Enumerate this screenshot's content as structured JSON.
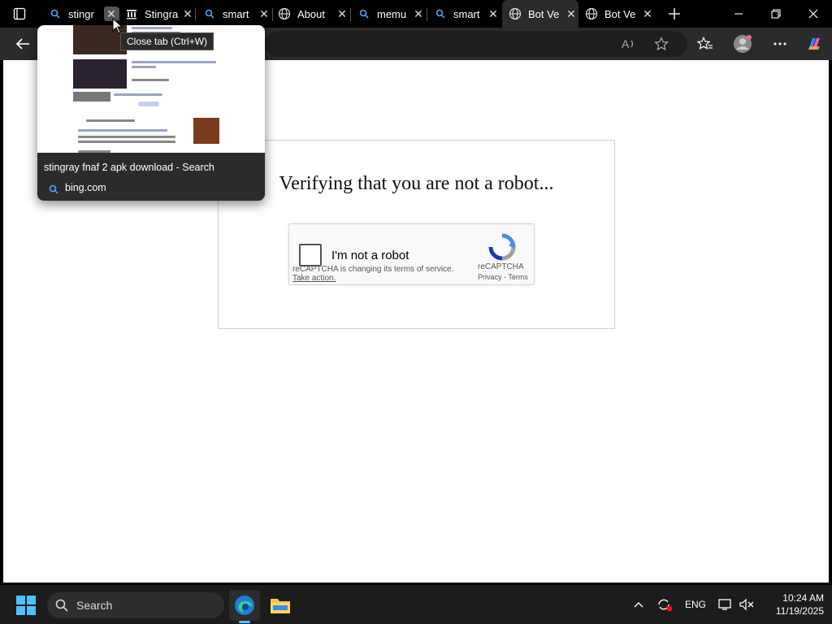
{
  "tabs": [
    {
      "title": "stingr",
      "icon": "search-icon",
      "active": false,
      "hovered": true
    },
    {
      "title": "Stingra",
      "icon": "library-icon",
      "active": false
    },
    {
      "title": "smart",
      "icon": "search-icon",
      "active": false
    },
    {
      "title": "About",
      "icon": "globe-icon",
      "active": false
    },
    {
      "title": "memu",
      "icon": "search-icon",
      "active": false
    },
    {
      "title": "smart",
      "icon": "search-icon",
      "active": false
    },
    {
      "title": "Bot Ve",
      "icon": "globe-icon",
      "active": true
    },
    {
      "title": "Bot Ve",
      "icon": "globe-icon",
      "active": false
    }
  ],
  "tooltip": "Close tab (Ctrl+W)",
  "hovercard": {
    "title": "stingray fnaf 2 apk download - Search",
    "domain": "bing.com"
  },
  "page": {
    "heading": "Verifying that you are not a robot...",
    "recaptcha": {
      "label": "I'm not a robot",
      "notice": "reCAPTCHA is changing its terms of service.",
      "action": "Take action.",
      "brand": "reCAPTCHA",
      "privacy": "Privacy",
      "terms": "Terms"
    }
  },
  "taskbar": {
    "search_label": "Search",
    "language": "ENG",
    "time": "10:24 AM",
    "date": "11/19/2025"
  },
  "colors": {
    "accent": "#4da3ff",
    "tab_active": "#2b2b2b",
    "recaptcha_blue": "#4a90e2"
  }
}
